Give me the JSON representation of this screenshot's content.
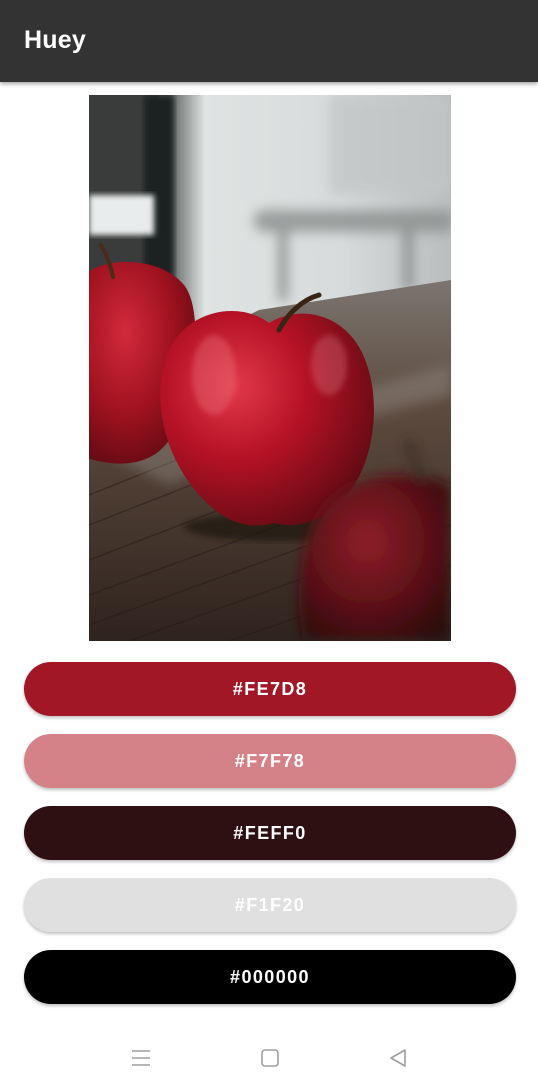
{
  "app": {
    "title": "Huey"
  },
  "photo": {
    "subject_icon": "apple-photo"
  },
  "palette": [
    {
      "label": "#FE7D8",
      "color": "#a11726"
    },
    {
      "label": "#F7F78",
      "color": "#d48188"
    },
    {
      "label": "#FEFF0",
      "color": "#2e1012"
    },
    {
      "label": "#F1F20",
      "color": "#e0e0e0"
    },
    {
      "label": "#000000",
      "color": "#000000"
    }
  ],
  "nav": {
    "menu_icon": "menu-icon",
    "home_icon": "home-icon",
    "back_icon": "back-icon",
    "icon_color": "#9e9e9e"
  }
}
